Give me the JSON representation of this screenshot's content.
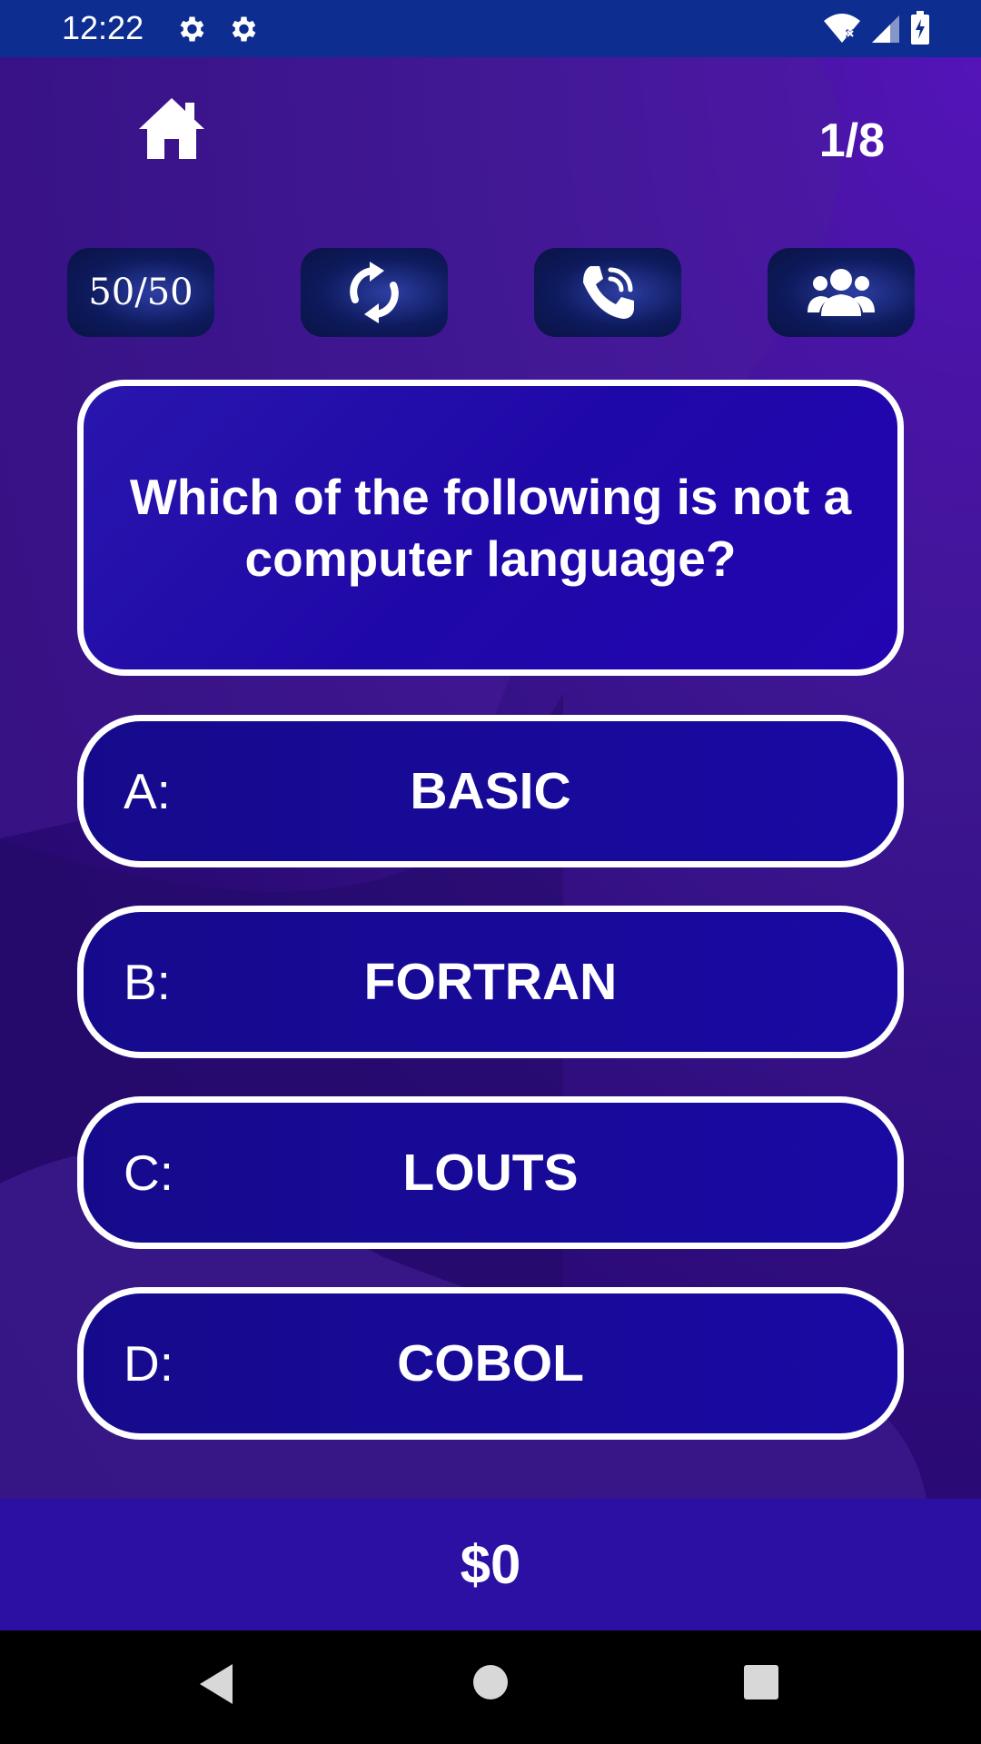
{
  "status_bar": {
    "time": "12:22",
    "icons": [
      "gear-icon",
      "gear-icon",
      "wifi-icon",
      "signal-icon",
      "battery-charging-icon"
    ]
  },
  "header": {
    "home_icon": "home-icon",
    "progress": "1/8"
  },
  "lifelines": {
    "fifty_fifty": "50/50",
    "swap_icon": "swap-question-icon",
    "phone_icon": "phone-friend-icon",
    "audience_icon": "ask-audience-icon"
  },
  "question": {
    "text": "Which of the following is not a computer language?"
  },
  "answers": [
    {
      "letter": "A:",
      "text": "BASIC"
    },
    {
      "letter": "B:",
      "text": "FORTRAN"
    },
    {
      "letter": "C:",
      "text": "LOUTS"
    },
    {
      "letter": "D:",
      "text": "COBOL"
    }
  ],
  "prize": "$0",
  "colors": {
    "status_bar": "#0d2d91",
    "background": "#2a0a75",
    "answer_fill": "#190aa3",
    "prize_bar": "#2c0fa3"
  }
}
